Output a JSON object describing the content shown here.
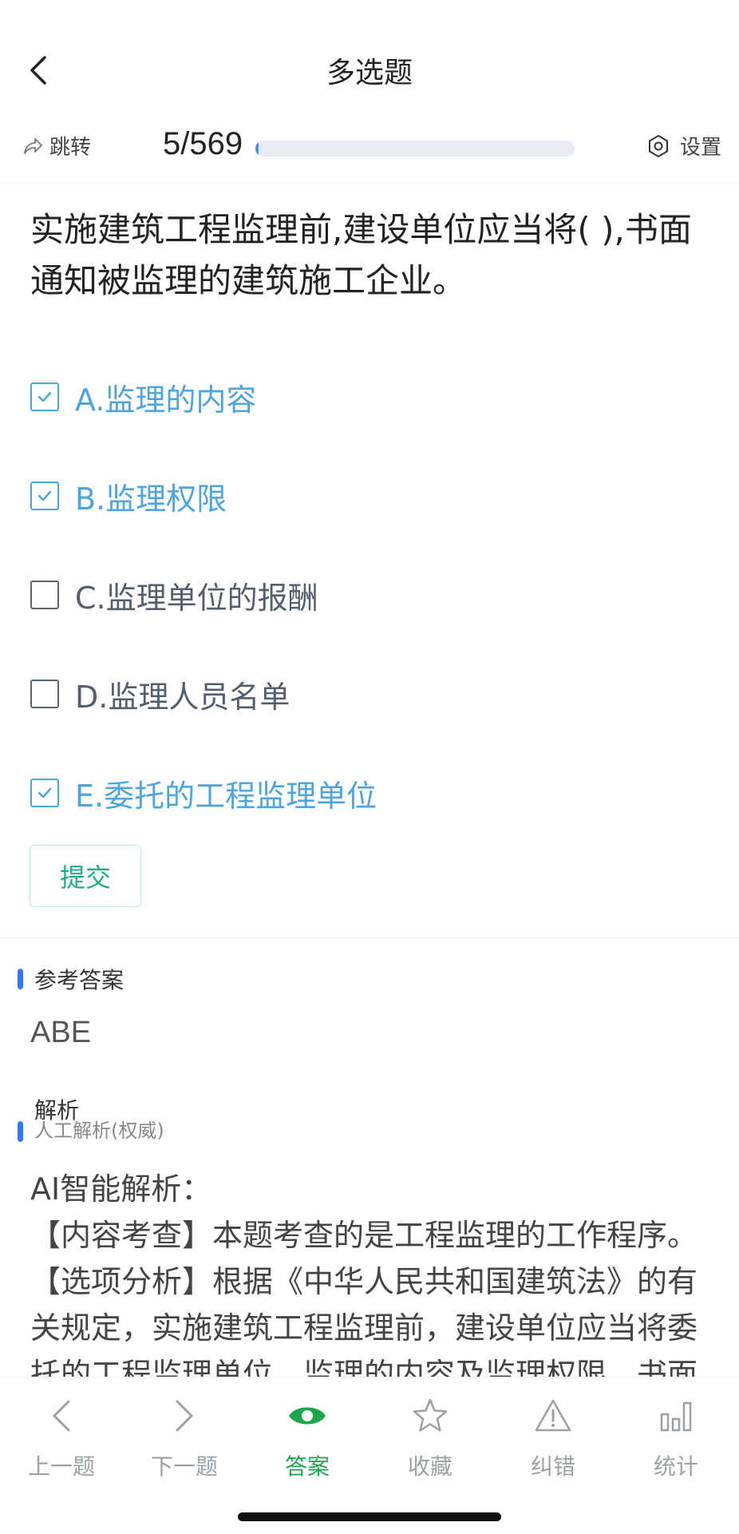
{
  "header": {
    "title": "多选题",
    "jump_label": "跳转",
    "progress_text": "5/569",
    "progress_fraction": 0.0088,
    "settings_label": "设置"
  },
  "question": {
    "text": "实施建筑工程监理前,建设单位应当将( ),书面通知被监理的建筑施工企业。",
    "options": [
      {
        "label": "A.监理的内容",
        "selected": true
      },
      {
        "label": "B.监理权限",
        "selected": true
      },
      {
        "label": "C.监理单位的报酬",
        "selected": false
      },
      {
        "label": "D.监理人员名单",
        "selected": false
      },
      {
        "label": "E.委托的工程监理单位",
        "selected": true
      }
    ],
    "submit_label": "提交"
  },
  "answer": {
    "title": "参考答案",
    "value": "ABE"
  },
  "analysis": {
    "title": "解析",
    "subtitle": "人工解析(权威)",
    "lines": [
      "AI智能解析：",
      "【内容考查】本题考查的是工程监理的工作程序。",
      "【选项分析】根据《中华人民共和国建筑法》的有关规定，实施建筑工程监理前，建设单位应当将委托的工程监理单位、监理的内容及监理权限，书面"
    ]
  },
  "tabbar": {
    "items": [
      {
        "label": "上一题",
        "icon": "chevron-left-icon",
        "active": false
      },
      {
        "label": "下一题",
        "icon": "chevron-right-icon",
        "active": false
      },
      {
        "label": "答案",
        "icon": "eye-icon",
        "active": true
      },
      {
        "label": "收藏",
        "icon": "star-icon",
        "active": false
      },
      {
        "label": "纠错",
        "icon": "warning-icon",
        "active": false
      },
      {
        "label": "统计",
        "icon": "bar-chart-icon",
        "active": false
      }
    ]
  },
  "colors": {
    "accent_blue": "#4ea4dc",
    "active_green": "#1ea64e",
    "submit_teal": "#1cae88",
    "section_bar": "#3478f6"
  }
}
